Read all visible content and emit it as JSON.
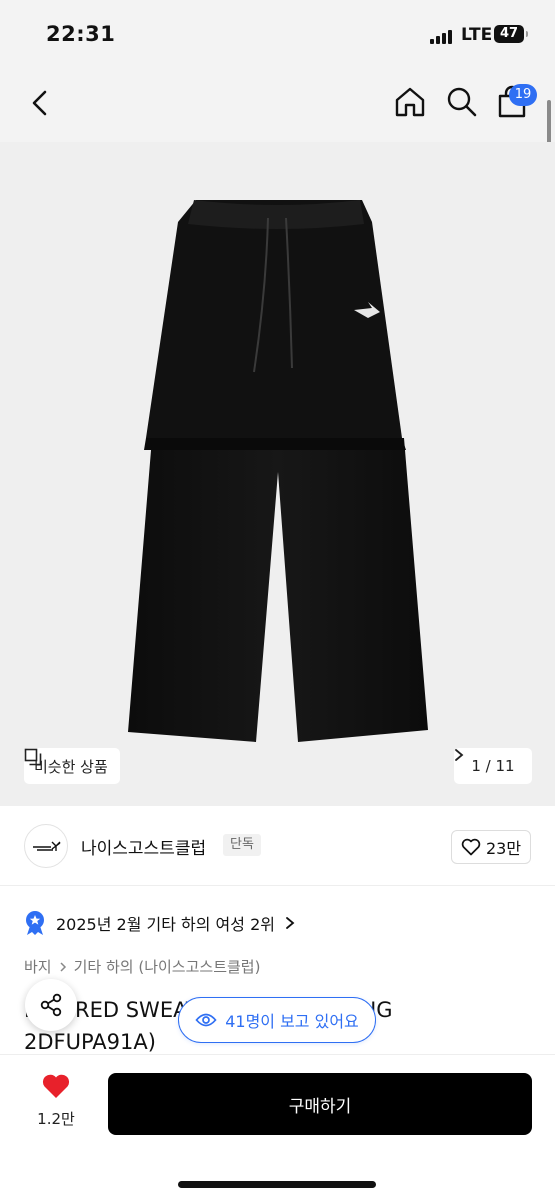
{
  "status": {
    "time": "22:31",
    "network": "LTE",
    "battery": "47"
  },
  "header": {
    "cart_count": "19"
  },
  "hero": {
    "similar_label": "비슷한 상품",
    "pager": "1 / 11"
  },
  "brand": {
    "name": "나이스고스트클럽",
    "tag": "단독",
    "likes": "23만"
  },
  "ranking": {
    "text": "2025년 2월 기타 하의 여성 2위"
  },
  "breadcrumb": {
    "level1": "바지",
    "level2": "기타 하의 (나이스고스트클럽)"
  },
  "product": {
    "title_line1": "LAYERED SWEAT PANTS_BLACK(NG",
    "title_line2": "2DFUPA91A)"
  },
  "overlay": {
    "viewers": "41명이 보고 있어요"
  },
  "bottom": {
    "wish_count": "1.2만",
    "buy_label": "구매하기"
  },
  "colors": {
    "accent": "#2f6ff3",
    "heart": "#e8212b",
    "buy_bg": "#000000"
  },
  "icons": [
    "back-icon",
    "home-icon",
    "search-icon",
    "cart-icon",
    "similar-icon",
    "chevron-right-icon",
    "heart-outline-icon",
    "rank-badge-icon",
    "share-icon",
    "eye-icon",
    "heart-filled-icon"
  ]
}
